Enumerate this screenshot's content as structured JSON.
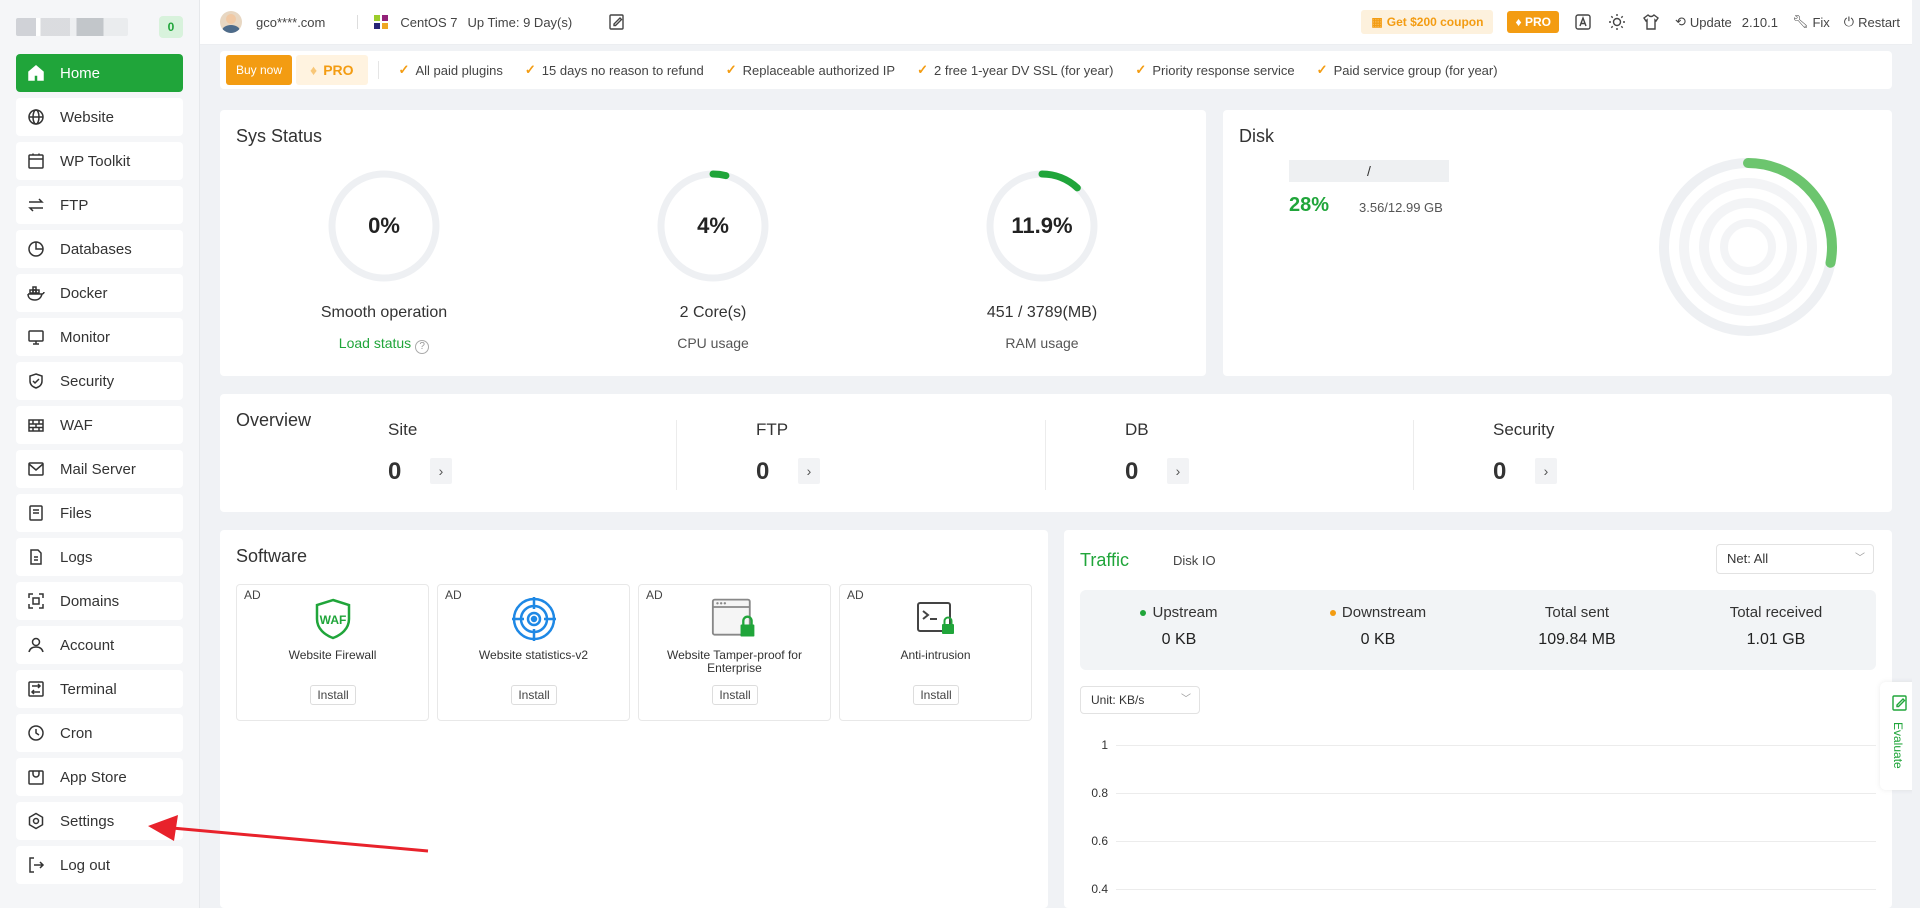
{
  "sidebar": {
    "badge": "0",
    "items": [
      {
        "label": "Home",
        "icon": "home-icon",
        "active": true
      },
      {
        "label": "Website",
        "icon": "globe-icon"
      },
      {
        "label": "WP Toolkit",
        "icon": "wordpress-icon"
      },
      {
        "label": "FTP",
        "icon": "transfer-icon"
      },
      {
        "label": "Databases",
        "icon": "database-icon"
      },
      {
        "label": "Docker",
        "icon": "docker-icon"
      },
      {
        "label": "Monitor",
        "icon": "monitor-icon"
      },
      {
        "label": "Security",
        "icon": "shield-icon"
      },
      {
        "label": "WAF",
        "icon": "firewall-icon"
      },
      {
        "label": "Mail Server",
        "icon": "mail-icon"
      },
      {
        "label": "Files",
        "icon": "folder-icon"
      },
      {
        "label": "Logs",
        "icon": "log-icon"
      },
      {
        "label": "Domains",
        "icon": "domain-icon"
      },
      {
        "label": "Account",
        "icon": "user-icon"
      },
      {
        "label": "Terminal",
        "icon": "terminal-icon"
      },
      {
        "label": "Cron",
        "icon": "clock-icon"
      },
      {
        "label": "App Store",
        "icon": "store-icon"
      },
      {
        "label": "Settings",
        "icon": "settings-icon"
      },
      {
        "label": "Log out",
        "icon": "logout-icon"
      }
    ]
  },
  "topbar": {
    "user": "gco****.com",
    "os": "CentOS 7",
    "uptime": "Up Time: 9 Day(s)",
    "coupon": "Get $200 coupon",
    "pro": "PRO",
    "update_label": "Update",
    "version": "2.10.1",
    "fix": "Fix",
    "restart": "Restart"
  },
  "promo": {
    "buy_now": "Buy now",
    "pro": "PRO",
    "perks": [
      "All paid plugins",
      "15 days no reason to refund",
      "Replaceable authorized IP",
      "2 free 1-year DV SSL (for year)",
      "Priority response service",
      "Paid service group (for year)"
    ]
  },
  "sys_status": {
    "title": "Sys Status",
    "load": {
      "value": "0%",
      "percent": 0,
      "label": "Smooth operation",
      "sub": "Load status",
      "help": "?"
    },
    "cpu": {
      "value": "4%",
      "percent": 4,
      "label": "2 Core(s)",
      "sub": "CPU usage"
    },
    "ram": {
      "value": "11.9%",
      "percent": 11.9,
      "label": "451 / 3789(MB)",
      "sub": "RAM usage"
    }
  },
  "disk": {
    "title": "Disk",
    "mount": "/",
    "percent_text": "28%",
    "percent": 28,
    "size": "3.56/12.99 GB"
  },
  "overview": {
    "title": "Overview",
    "items": [
      {
        "label": "Site",
        "count": "0",
        "arrow": "›"
      },
      {
        "label": "FTP",
        "count": "0",
        "arrow": "›"
      },
      {
        "label": "DB",
        "count": "0",
        "arrow": "›"
      },
      {
        "label": "Security",
        "count": "0",
        "arrow": "›"
      }
    ]
  },
  "software": {
    "title": "Software",
    "items": [
      {
        "ad": "AD",
        "name": "Website Firewall",
        "install": "Install",
        "icon": "waf-shield-icon"
      },
      {
        "ad": "AD",
        "name": "Website statistics-v2",
        "install": "Install",
        "icon": "statistics-target-icon"
      },
      {
        "ad": "AD",
        "name": "Website Tamper-proof for Enterprise",
        "install": "Install",
        "icon": "tamper-proof-lock-icon"
      },
      {
        "ad": "AD",
        "name": "Anti-intrusion",
        "install": "Install",
        "icon": "terminal-lock-icon"
      }
    ]
  },
  "traffic": {
    "tab_traffic": "Traffic",
    "tab_diskio": "Disk IO",
    "net_select": "Net: All",
    "unit_select": "Unit: KB/s",
    "stats": [
      {
        "label": "Upstream",
        "value": "0 KB",
        "dot_color": "#20a53a"
      },
      {
        "label": "Downstream",
        "value": "0 KB",
        "dot_color": "#f39c12"
      },
      {
        "label": "Total sent",
        "value": "109.84 MB"
      },
      {
        "label": "Total received",
        "value": "1.01 GB"
      }
    ],
    "y_ticks": [
      "1",
      "0.8",
      "0.6",
      "0.4"
    ]
  },
  "evaluate": "Evaluate",
  "colors": {
    "accent": "#20a53a",
    "pro": "#f39c12",
    "annotation": "#e8222b"
  }
}
